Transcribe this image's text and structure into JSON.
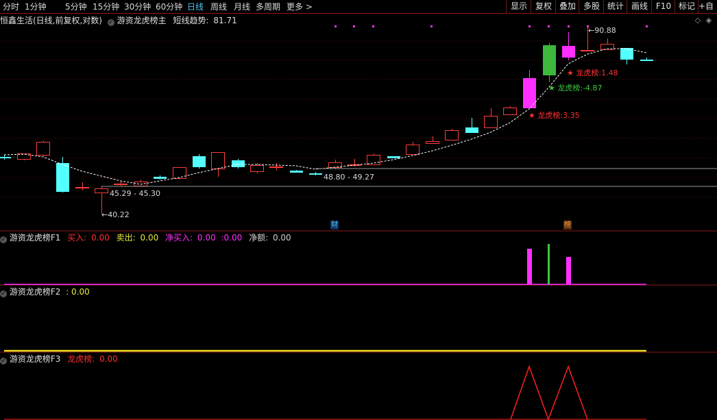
{
  "toolbar": {
    "periods": [
      "分时",
      "1分钟",
      "5分钟",
      "15分钟",
      "30分钟",
      "60分钟",
      "日线",
      "周线",
      "月线",
      "多周期",
      "更多"
    ],
    "active_period": "日线",
    "more_arrow": ">",
    "buttons": [
      "显示",
      "复权",
      "叠加",
      "多股",
      "统计",
      "画线",
      "F10",
      "标记",
      "+自选"
    ]
  },
  "main": {
    "stock_title": "恒鑫生活(日线,前复权,对数)",
    "indicator_name": "游资龙虎榜主",
    "trend_label": "短线趋势:",
    "trend_value": "81.71",
    "high_label": "90.88",
    "low_label": "40.22",
    "range_low": "45.29 - 45.30",
    "range_mid": "48.80 - 49.27",
    "lhb_labels": [
      {
        "text": "龙虎榜:3.35",
        "color": "#ff3030"
      },
      {
        "text": "龙虎榜:-4.87",
        "color": "#3cc83c"
      },
      {
        "text": "龙虎榜:1.48",
        "color": "#ff3030"
      }
    ],
    "markers": [
      {
        "text": "财",
        "color": "#4fc3f7"
      },
      {
        "text": "榜",
        "color": "#ff9a3c"
      }
    ]
  },
  "panel_f1": {
    "name": "游资龙虎榜F1",
    "buy_label": "买入:",
    "buy_value": "0.00",
    "sell_label": "卖出:",
    "sell_value": "0.00",
    "netbuy_label": "净买入:",
    "netbuy_value": "0.00",
    "netbuy_value2": ":0.00",
    "netamt_label": "净额:",
    "netamt_value": "0.00",
    "colors": {
      "buy": "#ff3030",
      "sell": "#e8e840",
      "netbuy": "#ff30ff",
      "netamt": "#d0d0d0"
    }
  },
  "panel_f2": {
    "name": "游资龙虎榜F2",
    "value": ": 0.00",
    "line_color": "#f0e020"
  },
  "panel_f3": {
    "name": "游资龙虎榜F3",
    "label": "龙虎榜:",
    "value": "0.00",
    "line_color": "#ff2020"
  },
  "colors": {
    "up": "#ff3c3c",
    "down": "#54ffff",
    "big_up": "#ff30ff",
    "big_down": "#3cb83c",
    "divider": "#8b1a1a"
  }
}
